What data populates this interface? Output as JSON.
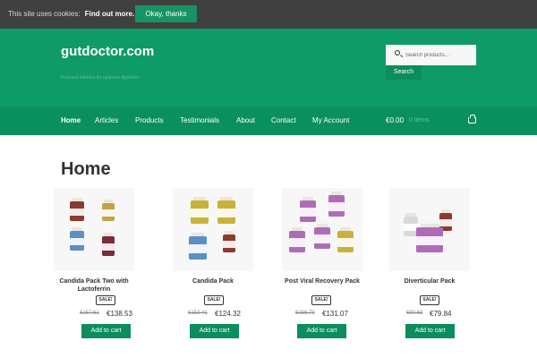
{
  "cookie_bar": {
    "text": "This site uses cookies:",
    "link_label": "Find out more.",
    "button_label": "Okay, thanks"
  },
  "header": {
    "site_title": "gutdoctor.com",
    "site_description": "Practical nutrition for optimum digestion",
    "search_placeholder": "Search products…",
    "search_button": "Search"
  },
  "nav": {
    "items": [
      {
        "label": "Home"
      },
      {
        "label": "Articles"
      },
      {
        "label": "Products"
      },
      {
        "label": "Testimonials"
      },
      {
        "label": "About"
      },
      {
        "label": "Contact"
      },
      {
        "label": "My Account"
      }
    ],
    "cart_total": "€0.00",
    "cart_count": "0 items"
  },
  "page": {
    "title": "Home"
  },
  "products": [
    {
      "name": "Candida Pack Two with Lactoferrin",
      "sale": "SALE!",
      "old_price": "€167.61",
      "price": "€138.53",
      "button": "Add to cart"
    },
    {
      "name": "Candida Pack",
      "sale": "SALE!",
      "old_price": "€153.41",
      "price": "€124.32",
      "button": "Add to cart"
    },
    {
      "name": "Post Viral Recovery Pack",
      "sale": "SALE!",
      "old_price": "€166.79",
      "price": "€131.07",
      "button": "Add to cart"
    },
    {
      "name": "Diverticular Pack",
      "sale": "SALE!",
      "old_price": "€90.63",
      "price": "€79.84",
      "button": "Add to cart"
    }
  ],
  "colors": {
    "brand_green": "#0f9b67",
    "nav_green": "#0a8f5e",
    "button_green": "#0b8d5d",
    "cookie_bar": "#404040"
  }
}
